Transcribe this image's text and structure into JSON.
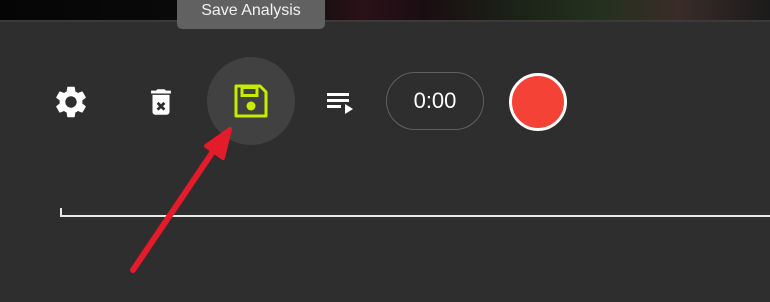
{
  "tooltip": {
    "text": "Save Analysis"
  },
  "toolbar": {
    "settings_icon": "gear-icon",
    "delete_icon": "trash-x-icon",
    "save_icon": "floppy-disk-icon",
    "playlist_icon": "playlist-play-icon",
    "timer": "0:00",
    "record_icon": "record-icon"
  },
  "colors": {
    "background": "#2e2e2e",
    "save_icon_accent": "#c6ec00",
    "record_red": "#f44336",
    "annotation_arrow": "#e31b2a"
  },
  "annotation": {
    "type": "arrow",
    "points_to": "save-button"
  }
}
